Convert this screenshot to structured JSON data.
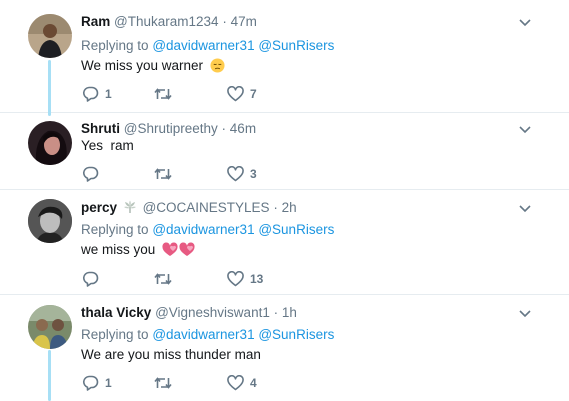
{
  "tweets": [
    {
      "name": "Ram",
      "handle": "@Thukaram1234",
      "dot": "·",
      "time": "47m",
      "replying_prefix": "Replying to",
      "mentions": [
        "@davidwarner31",
        "@SunRisers"
      ],
      "text": "We miss you warner",
      "emoji": "pensive-face",
      "reply_count": "1",
      "retweet_count": "",
      "like_count": "7"
    },
    {
      "name": "Shruti",
      "handle": "@Shrutipreethy",
      "dot": "·",
      "time": "46m",
      "text": "Yes  ram",
      "reply_count": "",
      "retweet_count": "",
      "like_count": "3"
    },
    {
      "name": "percy",
      "badge": "leaf-emoji",
      "handle": "@COCAINESTYLES",
      "dot": "·",
      "time": "2h",
      "replying_prefix": "Replying to",
      "mentions": [
        "@davidwarner31",
        "@SunRisers"
      ],
      "text": "we miss you",
      "emoji": "two-hearts",
      "reply_count": "",
      "retweet_count": "",
      "like_count": "13"
    },
    {
      "name": "thala Vicky",
      "handle": "@Vigneshviswant1",
      "dot": "·",
      "time": "1h",
      "replying_prefix": "Replying to",
      "mentions": [
        "@davidwarner31",
        "@SunRisers"
      ],
      "text": "We are you miss thunder man",
      "reply_count": "1",
      "retweet_count": "",
      "like_count": "4"
    }
  ],
  "colors": {
    "link": "#1b95e0",
    "secondary_text": "#657786",
    "thread_line": "#a7dff5",
    "divider": "#e6ecf0"
  }
}
